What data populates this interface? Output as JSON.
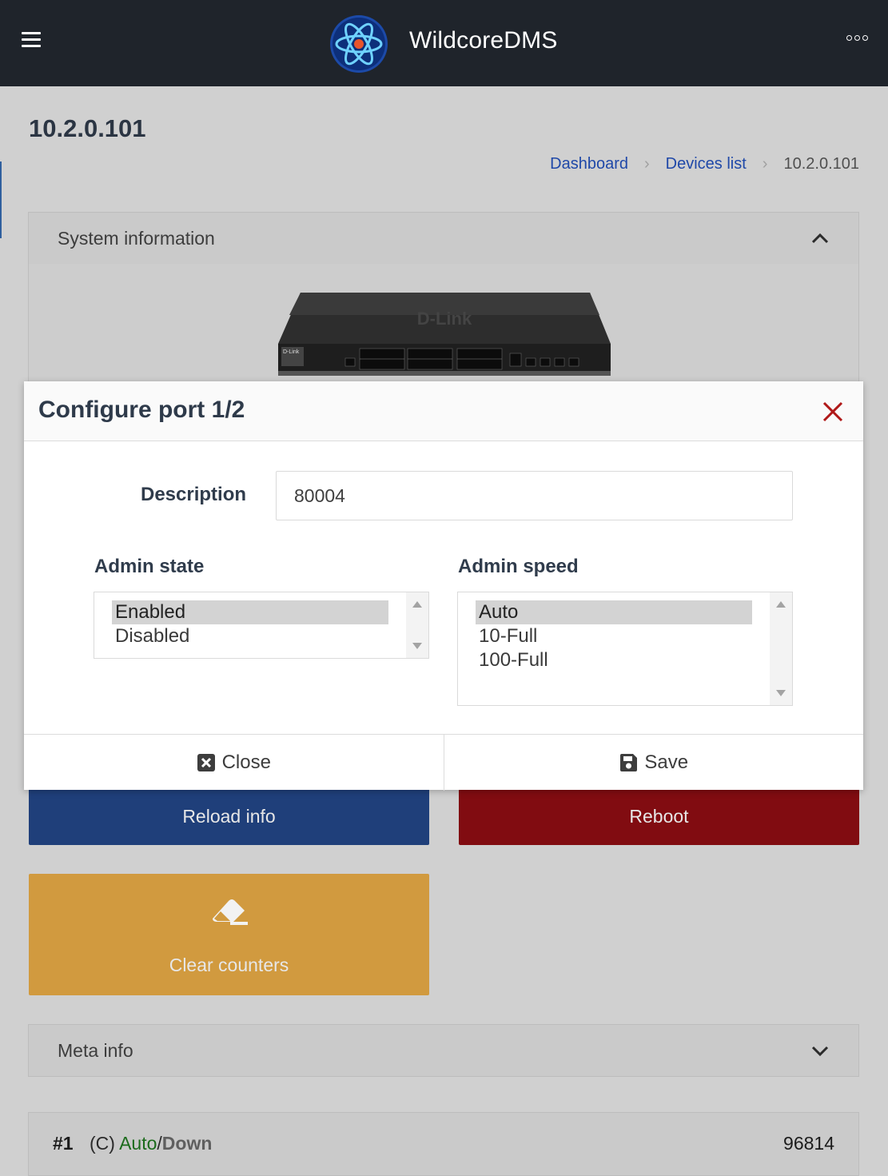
{
  "app": {
    "title": "WildcoreDMS"
  },
  "page": {
    "title": "10.2.0.101"
  },
  "breadcrumb": {
    "items": [
      "Dashboard",
      "Devices list"
    ],
    "current": "10.2.0.101"
  },
  "system_info": {
    "title": "System information",
    "device_image": "d-link-switch"
  },
  "modal": {
    "title": "Configure port 1/2",
    "description_label": "Description",
    "description_value": "80004",
    "admin_state": {
      "label": "Admin state",
      "options": [
        "Enabled",
        "Disabled"
      ],
      "selected": "Enabled"
    },
    "admin_speed": {
      "label": "Admin speed",
      "options": [
        "Auto",
        "10-Full",
        "100-Full"
      ],
      "selected": "Auto"
    },
    "close_label": "Close",
    "save_label": "Save"
  },
  "actions": {
    "reload": "Reload info",
    "reboot": "Reboot",
    "clear": "Clear counters"
  },
  "meta": {
    "title": "Meta info"
  },
  "port_row": {
    "number": "#1",
    "prefix": "(C)",
    "speed": "Auto",
    "slash": "/",
    "state": "Down",
    "description": "96814"
  },
  "colors": {
    "topbar": "#1f242b",
    "reload": "#1f3f7a",
    "reboot": "#810c11",
    "clear": "#d19a3f",
    "link": "#1f48a8",
    "close_icon": "#b01818"
  }
}
